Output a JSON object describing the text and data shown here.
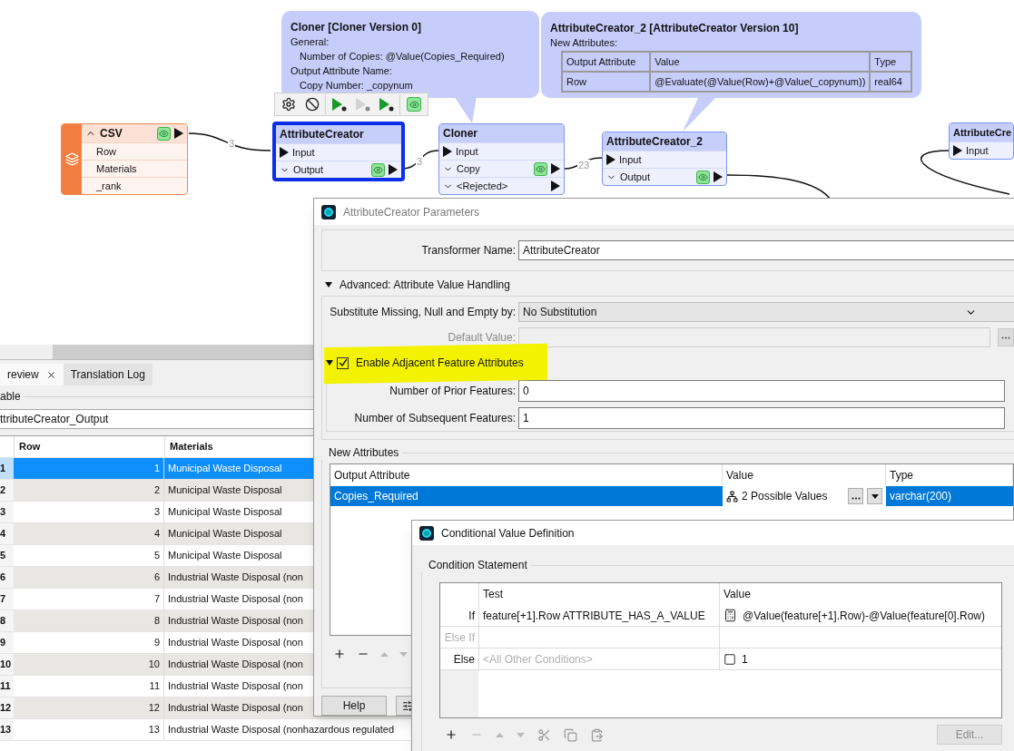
{
  "canvas": {
    "nodes": [
      {
        "kind": "reader",
        "title": "CSV",
        "expanded": true,
        "selected": false,
        "viewer": true,
        "ports": [
          {
            "label": "Row",
            "kind": "attribute"
          },
          {
            "label": "Materials",
            "kind": "attribute"
          },
          {
            "label": "_rank",
            "kind": "attribute"
          }
        ]
      },
      {
        "kind": "transformer",
        "title": "AttributeCreator",
        "selected": true,
        "ports": [
          {
            "label": "Input",
            "kind": "input"
          },
          {
            "label": "Output",
            "kind": "output",
            "viewer": true
          }
        ]
      },
      {
        "kind": "transformer",
        "title": "Cloner",
        "selected": false,
        "ports": [
          {
            "label": "Input",
            "kind": "input"
          },
          {
            "label": "Copy",
            "kind": "output",
            "viewer": true
          },
          {
            "label": "<Rejected>",
            "kind": "output",
            "viewer": false
          }
        ]
      },
      {
        "kind": "transformer",
        "title": "AttributeCreator_2",
        "selected": false,
        "ports": [
          {
            "label": "Input",
            "kind": "input"
          },
          {
            "label": "Output",
            "kind": "output",
            "viewer": true
          }
        ]
      },
      {
        "kind": "transformer",
        "title": "AttributeCre",
        "selected": false,
        "ports": [
          {
            "label": "Input",
            "kind": "input"
          }
        ]
      }
    ],
    "feature_counts": [
      "3",
      "3",
      "23"
    ],
    "node_toolbar": [
      {
        "kind": "settings",
        "disabled": false
      },
      {
        "kind": "disable",
        "disabled": false
      },
      {
        "kind": "run_to",
        "disabled": false
      },
      {
        "kind": "run_from",
        "disabled": true
      },
      {
        "kind": "run_partial",
        "disabled": false
      },
      {
        "kind": "inspect",
        "disabled": false
      }
    ],
    "tooltips": [
      {
        "title": "Cloner [Cloner Version 0]",
        "lines": [
          {
            "text": "General:",
            "children": [
              {
                "text": "Number of Copies: @Value(Copies_Required)"
              }
            ]
          },
          {
            "text": "Output Attribute Name:",
            "children": [
              {
                "text": "Copy Number: _copynum"
              }
            ]
          }
        ]
      },
      {
        "title": "AttributeCreator_2 [AttributeCreator Version 10]",
        "lines": [
          {
            "text": "New Attributes:"
          }
        ],
        "table": {
          "columns": [
            "Output Attribute",
            "Value",
            "Type"
          ],
          "rows": [
            [
              "Row",
              "@Evaluate(@Value(Row)+@Value(_copynum))",
              "real64"
            ]
          ]
        }
      }
    ]
  },
  "preview": {
    "tabs": [
      {
        "label": "review",
        "selected": true,
        "closable": true
      },
      {
        "label": "Translation Log",
        "selected": false,
        "closable": false
      }
    ],
    "group_label": "able",
    "table_name": "ttributeCreator_Output",
    "columns": [
      "Row",
      "Materials"
    ],
    "rows": [
      {
        "index": "1",
        "row": "1",
        "material": "Municipal Waste Disposal",
        "selected": true
      },
      {
        "index": "2",
        "row": "2",
        "material": "Municipal Waste Disposal",
        "selected": false
      },
      {
        "index": "3",
        "row": "3",
        "material": "Municipal Waste Disposal",
        "selected": false
      },
      {
        "index": "4",
        "row": "4",
        "material": "Municipal Waste Disposal",
        "selected": false
      },
      {
        "index": "5",
        "row": "5",
        "material": "Municipal Waste Disposal",
        "selected": false
      },
      {
        "index": "6",
        "row": "6",
        "material": "Industrial Waste Disposal (non",
        "selected": false
      },
      {
        "index": "7",
        "row": "7",
        "material": "Industrial Waste Disposal (non",
        "selected": false
      },
      {
        "index": "8",
        "row": "8",
        "material": "Industrial Waste Disposal (non",
        "selected": false
      },
      {
        "index": "9",
        "row": "9",
        "material": "Industrial Waste Disposal (non",
        "selected": false
      },
      {
        "index": "10",
        "row": "10",
        "material": "Industrial Waste Disposal (non",
        "selected": false
      },
      {
        "index": "11",
        "row": "11",
        "material": "Industrial Waste Disposal (non",
        "selected": false
      },
      {
        "index": "12",
        "row": "12",
        "material": "Industrial Waste Disposal (non",
        "selected": false
      },
      {
        "index": "13",
        "row": "13",
        "material": "Industrial Waste Disposal (nonhazardous regulated",
        "selected": false
      }
    ]
  },
  "parameters_dialog": {
    "title": "AttributeCreator Parameters",
    "transformer_name": {
      "label": "Transformer Name:",
      "value": "AttributeCreator"
    },
    "advanced": {
      "label": "Advanced: Attribute Value Handling",
      "expanded": true,
      "substitute": {
        "label": "Substitute Missing, Null and Empty by:",
        "value": "No Substitution"
      },
      "default_value": {
        "label": "Default Value:",
        "disabled": true
      },
      "adjacent": {
        "label": "Enable Adjacent Feature Attributes",
        "checked": true,
        "expanded": true,
        "highlighted": true
      },
      "prior": {
        "label": "Number of Prior Features:",
        "value": "0"
      },
      "subsequent": {
        "label": "Number of Subsequent Features:",
        "value": "1"
      }
    },
    "new_attributes": {
      "label": "New Attributes",
      "columns": [
        "Output Attribute",
        "Value",
        "Type"
      ],
      "rows": [
        {
          "output_attribute": "Copies_Required",
          "value": "2 Possible Values",
          "type": "varchar(200)",
          "selected": true
        }
      ]
    },
    "buttons": [
      "Help"
    ]
  },
  "conditional_dialog": {
    "title": "Conditional Value Definition",
    "group_label": "Condition Statement",
    "columns": [
      "Test",
      "Value"
    ],
    "rows": [
      {
        "label": "If",
        "test": "feature[+1].Row ATTRIBUTE_HAS_A_VALUE",
        "value": "@Value(feature[+1].Row)-@Value(feature[0].Row)",
        "kind": "expression",
        "disabled": false
      },
      {
        "label": "Else If",
        "disabled": true
      },
      {
        "label": "Else",
        "test_placeholder": "<All Other Conditions>",
        "value": "1",
        "kind": "constant",
        "disabled": false
      }
    ],
    "edit_button": {
      "label": "Edit...",
      "disabled": true
    }
  }
}
